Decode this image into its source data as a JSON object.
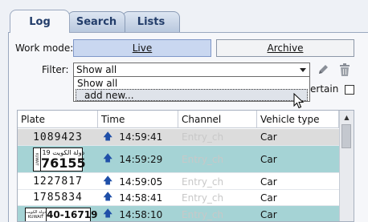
{
  "tabs": [
    {
      "label": "Log"
    },
    {
      "label": "Search"
    },
    {
      "label": "Lists"
    }
  ],
  "work_mode": {
    "label": "Work mode:",
    "live_label": "Live",
    "archive_label": "Archive"
  },
  "filter": {
    "label": "Filter:",
    "value": "Show all",
    "options": [
      "Show all",
      "add new..."
    ]
  },
  "certain_label": "ertain",
  "table": {
    "columns": [
      "Plate",
      "Time",
      "Channel",
      "Vehicle type"
    ],
    "rows": [
      {
        "plate": "1089423",
        "time": "14:59:41",
        "channel": "Entry_ch",
        "vehicle": "Car"
      },
      {
        "plate_top": "19 دولة الكويت",
        "plate": "76155",
        "plate_side": "KUWAIT",
        "time": "14:59:29",
        "channel": "Entry_ch",
        "vehicle": "Car"
      },
      {
        "plate": "1227817",
        "time": "14:59:05",
        "channel": "Entry_ch",
        "vehicle": "Car"
      },
      {
        "plate": "1785834",
        "time": "14:58:41",
        "channel": "Entry_ch",
        "vehicle": "Car"
      },
      {
        "plate": "40-16719",
        "plate_top": "دولة الكويت",
        "plate_side": "KUWAIT",
        "time": "14:58:10",
        "channel": "Entry_ch",
        "vehicle": "Car"
      }
    ]
  },
  "colors": {
    "live_active": "#c9d7f0",
    "selected_row": "#a5d3d5",
    "direction_arrow": "#1f4fa8"
  },
  "icons": [
    "pencil-icon",
    "trash-icon",
    "dropdown-arrow-icon",
    "arrow-up-icon",
    "mouse-cursor-icon"
  ]
}
